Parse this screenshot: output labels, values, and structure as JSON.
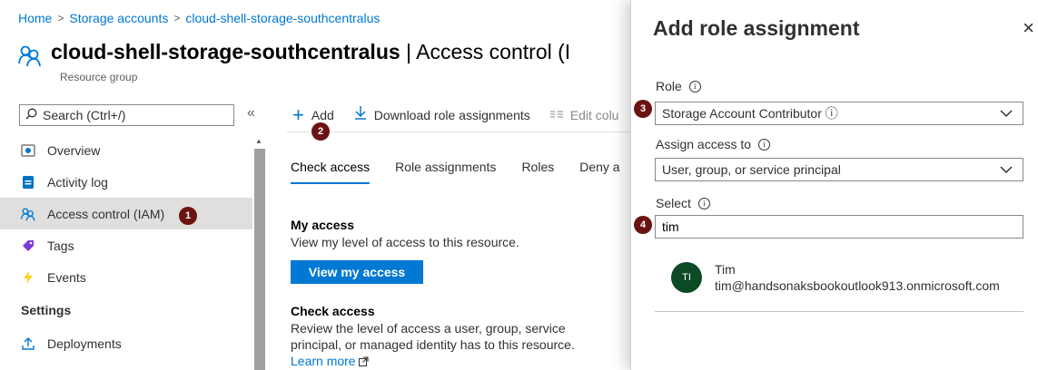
{
  "breadcrumb": {
    "items": [
      "Home",
      "Storage accounts",
      "cloud-shell-storage-southcentralus"
    ],
    "separator": ">"
  },
  "header": {
    "title_bold": "cloud-shell-storage-southcentralus",
    "title_rest": " | Access control (I",
    "subtitle": "Resource group",
    "icon": "people-icon"
  },
  "sidebar": {
    "search_placeholder": "Search (Ctrl+/)",
    "collapse_glyph": "«",
    "items": [
      {
        "label": "Overview",
        "icon": "overview-icon"
      },
      {
        "label": "Activity log",
        "icon": "activity-log-icon"
      },
      {
        "label": "Access control (IAM)",
        "icon": "people-icon",
        "active": true
      },
      {
        "label": "Tags",
        "icon": "tag-icon"
      },
      {
        "label": "Events",
        "icon": "lightning-icon"
      }
    ],
    "section_settings": "Settings",
    "settings_items": [
      {
        "label": "Deployments",
        "icon": "upload-icon"
      }
    ]
  },
  "toolbar": {
    "add_label": "Add",
    "download_label": "Download role assignments",
    "edit_label": "Edit colu"
  },
  "tabs": [
    "Check access",
    "Role assignments",
    "Roles",
    "Deny a"
  ],
  "my_access": {
    "heading": "My access",
    "text": "View my level of access to this resource.",
    "button": "View my access"
  },
  "check_access": {
    "heading": "Check access",
    "line1": "Review the level of access a user, group, service",
    "line2": "principal, or managed identity has to this resource.",
    "link": "Learn more"
  },
  "panel": {
    "title": "Add role assignment",
    "close": "×",
    "role_label": "Role",
    "role_value": "Storage Account Contributor ⓘ",
    "assign_label": "Assign access to",
    "assign_value": "User, group, or service principal",
    "select_label": "Select",
    "select_value": "tim",
    "user": {
      "initials": "TI",
      "name": "Tim",
      "email": "tim@handsonaksbookoutlook913.onmicrosoft.com"
    }
  },
  "badges": [
    "1",
    "2",
    "3",
    "4"
  ],
  "colors": {
    "accent": "#0078d4",
    "badge": "#6b1212",
    "avatar": "#0b4a24",
    "active_nav": "#e1dfdd"
  }
}
